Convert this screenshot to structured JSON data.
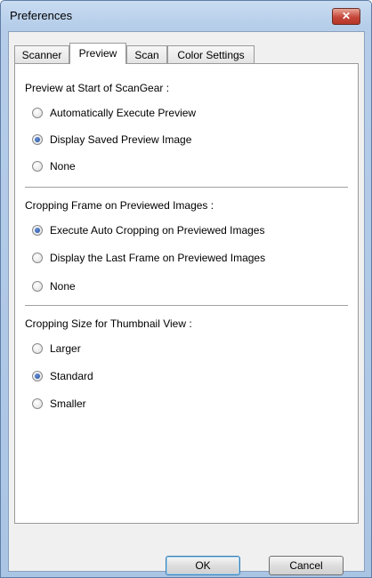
{
  "window": {
    "title": "Preferences",
    "close_label": "✕"
  },
  "tabs": [
    {
      "label": "Scanner",
      "active": false
    },
    {
      "label": "Preview",
      "active": true
    },
    {
      "label": "Scan",
      "active": false
    },
    {
      "label": "Color Settings",
      "active": false
    }
  ],
  "sections": [
    {
      "title": "Preview at Start of ScanGear :",
      "options": [
        {
          "label": "Automatically Execute Preview",
          "checked": false
        },
        {
          "label": "Display Saved Preview Image",
          "checked": true
        },
        {
          "label": "None",
          "checked": false
        }
      ]
    },
    {
      "title": "Cropping Frame on Previewed Images :",
      "options": [
        {
          "label": "Execute Auto Cropping on Previewed Images",
          "checked": true
        },
        {
          "label": "Display the Last Frame on Previewed Images",
          "checked": false
        },
        {
          "label": "None",
          "checked": false
        }
      ]
    },
    {
      "title": "Cropping Size for Thumbnail View :",
      "options": [
        {
          "label": "Larger",
          "checked": false
        },
        {
          "label": "Standard",
          "checked": true
        },
        {
          "label": "Smaller",
          "checked": false
        }
      ]
    }
  ],
  "buttons": {
    "ok_label": "OK",
    "cancel_label": "Cancel"
  }
}
